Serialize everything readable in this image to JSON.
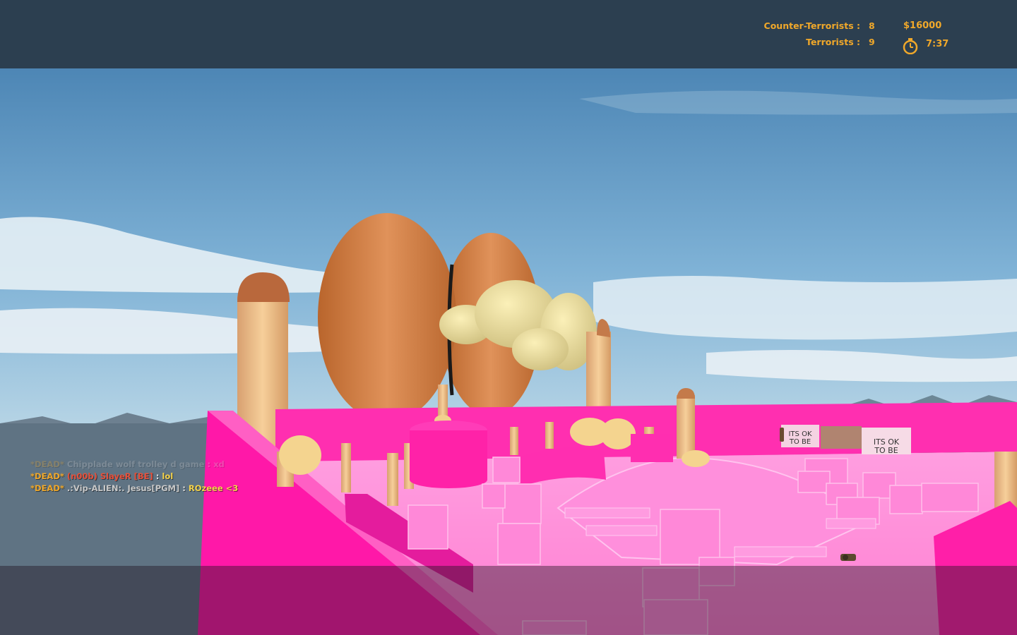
{
  "hud": {
    "ct_label": "Counter-Terrorists :",
    "ct_score": "8",
    "t_label": "Terrorists :",
    "t_score": "9",
    "money": "$16000",
    "timer": "7:37"
  },
  "chat": [
    {
      "tag": "*DEAD*",
      "name": "Chipplade",
      "sep": ":",
      "message": "xd",
      "partial": "wolf trolley d game",
      "faded": true
    },
    {
      "tag": "*DEAD*",
      "name": "(n00b) SlayeR [BE]",
      "sep": ":",
      "message": "lol"
    },
    {
      "tag": "*DEAD*",
      "name": ".:Vip-ALIEN:. Jesus[PGM]",
      "sep": ":",
      "message": "ROzeee <3"
    }
  ],
  "scene": {
    "signs": [
      {
        "text_line1": "ITS OK",
        "text_line2": "TO BE"
      },
      {
        "text_line1": "ITS OK",
        "text_line2": "TO BE"
      }
    ]
  },
  "colors": {
    "hud_text": "#f0a82a",
    "top_bar": "#2c3f50",
    "arena_pink": "#ff2fb0",
    "floor_pink": "#ff8ad8",
    "sky_top": "#4e8ab8",
    "sky_bottom": "#a9cde2"
  },
  "icons": {
    "timer": "stopwatch-icon"
  }
}
